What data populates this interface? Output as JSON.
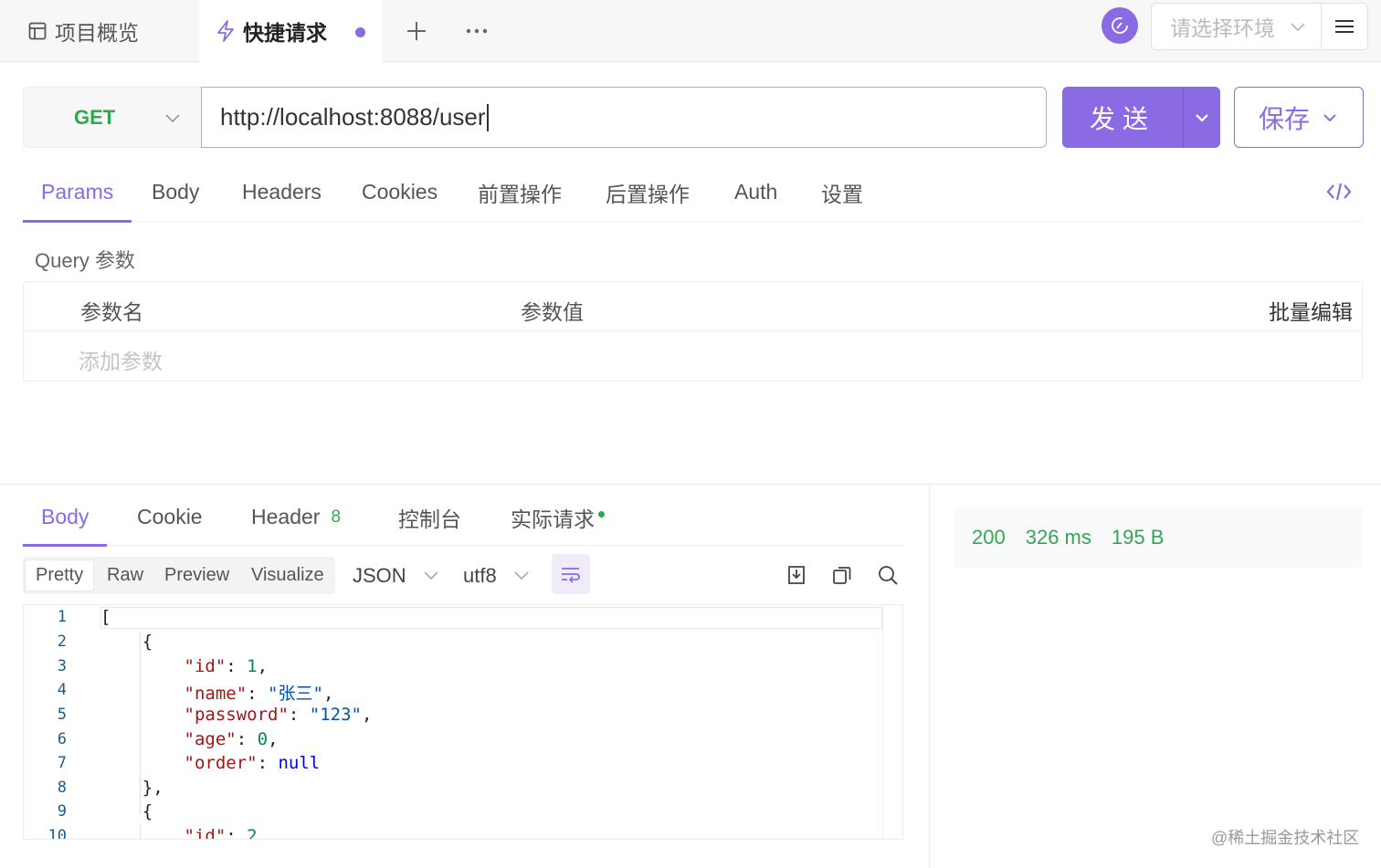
{
  "tabs": {
    "overview_label": "项目概览",
    "quick_label": "快捷请求"
  },
  "env": {
    "placeholder": "请选择环境"
  },
  "request": {
    "method": "GET",
    "url": "http://localhost:8088/user",
    "send_label": "发送",
    "save_label": "保存"
  },
  "req_tabs": [
    "Params",
    "Body",
    "Headers",
    "Cookies",
    "前置操作",
    "后置操作",
    "Auth",
    "设置"
  ],
  "params": {
    "section_label": "Query 参数",
    "col_name": "参数名",
    "col_value": "参数值",
    "bulk_edit": "批量编辑",
    "add_placeholder": "添加参数"
  },
  "resp_tabs": {
    "body": "Body",
    "cookie": "Cookie",
    "header": "Header",
    "header_count": "8",
    "console": "控制台",
    "actual": "实际请求"
  },
  "view_modes": [
    "Pretty",
    "Raw",
    "Preview",
    "Visualize"
  ],
  "format": {
    "type": "JSON",
    "encoding": "utf8"
  },
  "code_lines": [
    "1",
    "2",
    "3",
    "4",
    "5",
    "6",
    "7",
    "8",
    "9",
    "10"
  ],
  "status": {
    "code": "200",
    "time": "326 ms",
    "size": "195 B"
  },
  "watermark": "@稀土掘金技术社区",
  "colors": {
    "accent": "#8a6be3",
    "success": "#2fa84f"
  }
}
